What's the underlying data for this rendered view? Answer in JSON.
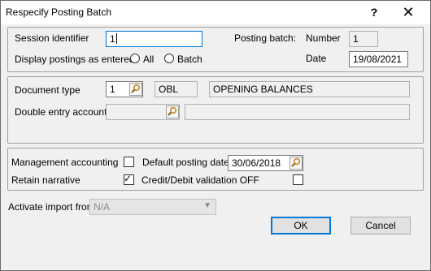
{
  "window": {
    "title": "Respecify Posting Batch",
    "help": "?",
    "close": "✕"
  },
  "session": {
    "label": "Session identifier",
    "value": "1",
    "display_label": "Display postings as entered",
    "radio_all": "All",
    "radio_batch": "Batch",
    "posting_batch_label": "Posting batch:",
    "number_label": "Number",
    "number_value": "1",
    "date_label": "Date",
    "date_value": "19/08/2021"
  },
  "document": {
    "type_label": "Document type",
    "type_number": "1",
    "type_code": "OBL",
    "type_description": "OPENING BALANCES",
    "double_entry_label": "Double entry account",
    "double_entry_value": "",
    "double_entry_description": ""
  },
  "options": {
    "management_accounting_label": "Management accounting",
    "management_accounting_checked": false,
    "default_posting_date_label": "Default posting date",
    "default_posting_date_value": "30/06/2018",
    "retain_narrative_label": "Retain narrative",
    "retain_narrative_checked": true,
    "credit_debit_label": "Credit/Debit validation OFF",
    "credit_debit_checked": false
  },
  "import": {
    "label": "Activate import from",
    "selected": "N/A"
  },
  "buttons": {
    "ok": "OK",
    "cancel": "Cancel"
  }
}
